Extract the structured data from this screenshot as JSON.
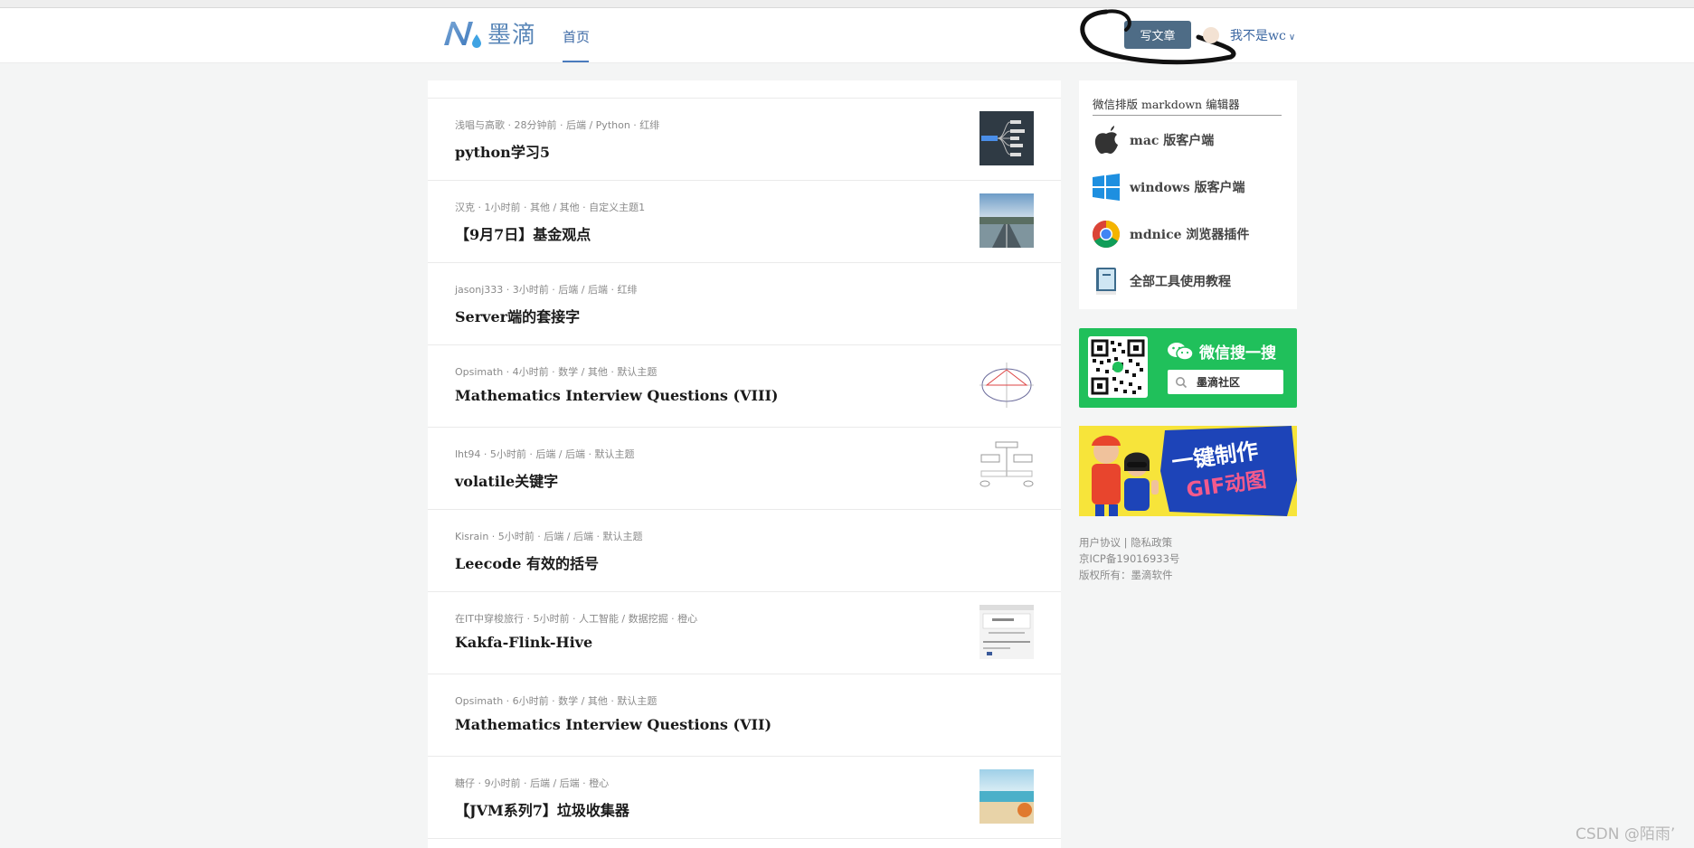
{
  "header": {
    "logo_text": "墨滴",
    "nav_home": "首页",
    "write_button": "写文章",
    "username": "我不是wc",
    "username_chevron": "∨"
  },
  "feed": {
    "items": [
      {
        "meta": "浅唱与高歌 · 28分钟前 · 后端 / Python · 红绯",
        "title": "python学习5",
        "has_thumb": true,
        "thumb": "mindmap"
      },
      {
        "meta": "汉克 · 1小时前 · 其他 / 其他 · 自定义主题1",
        "title": "【9月7日】基金观点",
        "has_thumb": true,
        "thumb": "road"
      },
      {
        "meta": "jasonj333 · 3小时前 · 后端 / 后端 · 红绯",
        "title": "Server端的套接字",
        "has_thumb": false
      },
      {
        "meta": "Opsimath · 4小时前 · 数学 / 其他 · 默认主题",
        "title": "Mathematics Interview Questions (VIII)",
        "has_thumb": true,
        "thumb": "ellipse"
      },
      {
        "meta": "lht94 · 5小时前 · 后端 / 后端 · 默认主题",
        "title": "volatile关键字",
        "has_thumb": true,
        "thumb": "flow"
      },
      {
        "meta": "Kisrain · 5小时前 · 后端 / 后端 · 默认主题",
        "title": "Leecode 有效的括号",
        "has_thumb": false
      },
      {
        "meta": "在IT中穿梭旅行 · 5小时前 · 人工智能 / 数据挖掘 · 橙心",
        "title": "Kakfa-Flink-Hive",
        "has_thumb": true,
        "thumb": "doc"
      },
      {
        "meta": "Opsimath · 6小时前 · 数学 / 其他 · 默认主题",
        "title": "Mathematics Interview Questions (VII)",
        "has_thumb": false
      },
      {
        "meta": "糖仔 · 9小时前 · 后端 / 后端 · 橙心",
        "title": "【JVM系列7】垃圾收集器",
        "has_thumb": true,
        "thumb": "beach"
      }
    ]
  },
  "sidebar": {
    "heading": "微信排版 markdown 编辑器",
    "tools": [
      {
        "label": "mac 版客户端",
        "icon": "apple-icon"
      },
      {
        "label": "windows 版客户端",
        "icon": "windows-icon"
      },
      {
        "label": "mdnice 浏览器插件",
        "icon": "chrome-icon"
      },
      {
        "label": "全部工具使用教程",
        "icon": "book-icon"
      }
    ],
    "wechat_title": "微信搜一搜",
    "wechat_search": "墨滴社区",
    "banner_line1": "一键制作",
    "banner_line2": "GIF动图",
    "footer_links": "用户协议 | 隐私政策",
    "icp": "京ICP备19016933号",
    "copyright": "版权所有：墨滴软件"
  },
  "watermark": "CSDN @陌雨’",
  "colors": {
    "accent": "#4a7bbd",
    "button": "#4e6c86",
    "wechat_green": "#20c05b",
    "banner_yellow": "#f7e43a"
  }
}
